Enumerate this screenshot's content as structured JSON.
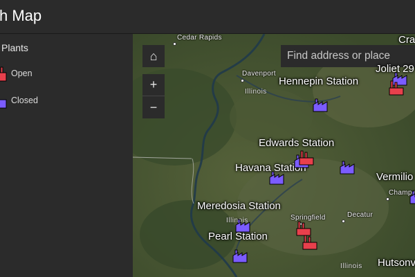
{
  "header": {
    "title": "sh Map"
  },
  "legend": {
    "title": "Plants",
    "items": [
      {
        "label": "Open",
        "color": "#e8404c"
      },
      {
        "label": "Closed",
        "color": "#7b5cff"
      }
    ]
  },
  "map": {
    "search_placeholder": "Find address or place",
    "home_symbol": "⌂",
    "zoom_in_symbol": "+",
    "zoom_out_symbol": "−",
    "cities": [
      "Cedar Rapids",
      "Davenport",
      "Springfield",
      "Decatur",
      "Champa"
    ],
    "states": [
      "Illinois",
      "Illinois",
      "Illinois"
    ],
    "stations": [
      "Hennepin Station",
      "Edwards Station",
      "Havana Station",
      "Meredosia Station",
      "Pearl Station",
      "Vermilio",
      "Hutsonv",
      "Joliet 29",
      "Cra"
    ]
  }
}
